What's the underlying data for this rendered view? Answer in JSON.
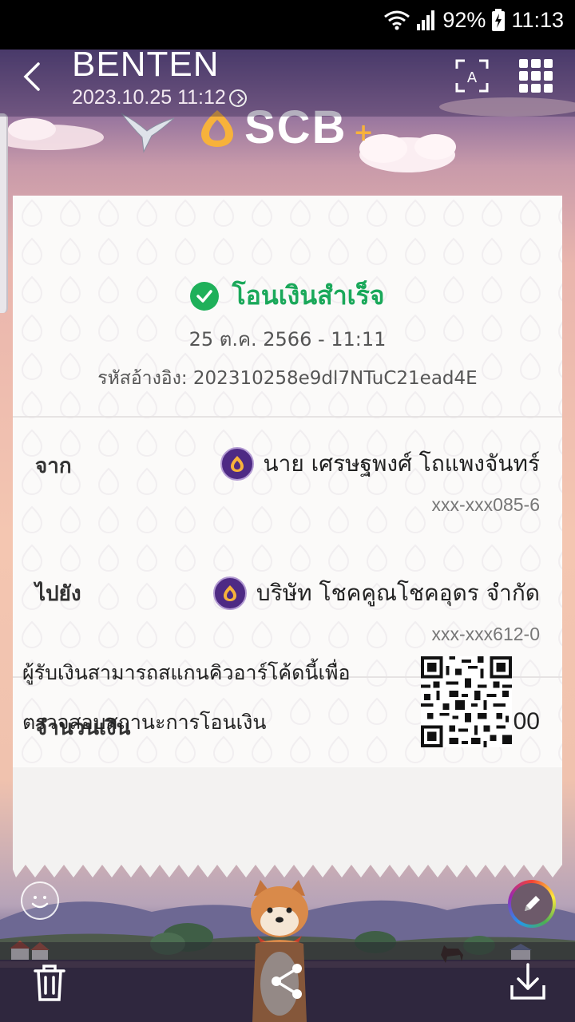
{
  "status_bar": {
    "battery": "92%",
    "time": "11:13",
    "icons": [
      "wifi-icon",
      "signal-icon",
      "battery-charging-icon"
    ]
  },
  "viewer": {
    "sender_name": "BENTEN",
    "sent_time": "2023.10.25 11:12",
    "icons": [
      "back-icon",
      "text-scan-icon",
      "grid-icon"
    ]
  },
  "slip": {
    "bank_logo": "SCB",
    "status": "โอนเงินสำเร็จ",
    "datetime": "25 ต.ค. 2566 - 11:11",
    "reference": "รหัสอ้างอิง: 202310258e9dl7NTuC21ead4E",
    "from": {
      "label": "จาก",
      "name": "นาย เศรษฐพงศ์ โถแพงจันทร์",
      "account": "xxx-xxx085-6"
    },
    "to": {
      "label": "ไปยัง",
      "name": "บริษัท โชคคูณโชคอุดร จำกัด",
      "account": "xxx-xxx612-0"
    },
    "amount": {
      "label": "จำนวนเงิน",
      "value": "5,000.00"
    },
    "qr_note_line1": "ผู้รับเงินสามารถสแกนคิวอาร์โค้ดนี้เพื่อ",
    "qr_note_line2": "ตรวจสอบสถานะการโอนเงิน"
  },
  "bottom_bar": {
    "icons": [
      "trash-icon",
      "share-icon",
      "download-icon"
    ]
  },
  "colors": {
    "success_green": "#1aa85a",
    "scb_purple": "#4e2a84",
    "scb_gold": "#f7b23b"
  }
}
